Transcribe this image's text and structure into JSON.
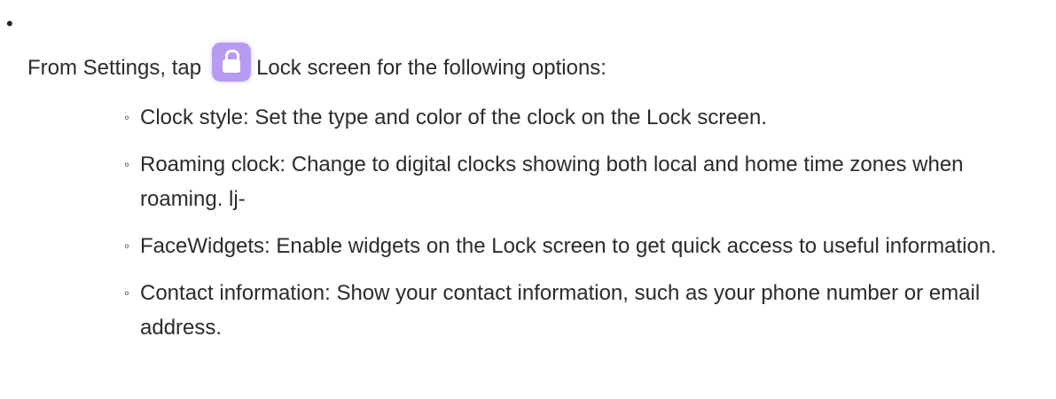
{
  "intro": {
    "bullet": "•",
    "text_before": "From Settings, tap",
    "icon": "lock-icon",
    "icon_color": "#b79af2",
    "text_after": "Lock screen for the following options:"
  },
  "options": [
    {
      "marker": "◦",
      "text": "Clock style: Set the type and color of the clock on the Lock screen."
    },
    {
      "marker": "◦",
      "text": "Roaming clock: Change to digital clocks showing both local and home time zones when roaming. lj-"
    },
    {
      "marker": "◦",
      "text": "FaceWidgets: Enable widgets on the Lock screen to get quick access to useful information."
    },
    {
      "marker": "◦",
      "text": "Contact information: Show your contact information, such as your phone number or email address."
    }
  ]
}
